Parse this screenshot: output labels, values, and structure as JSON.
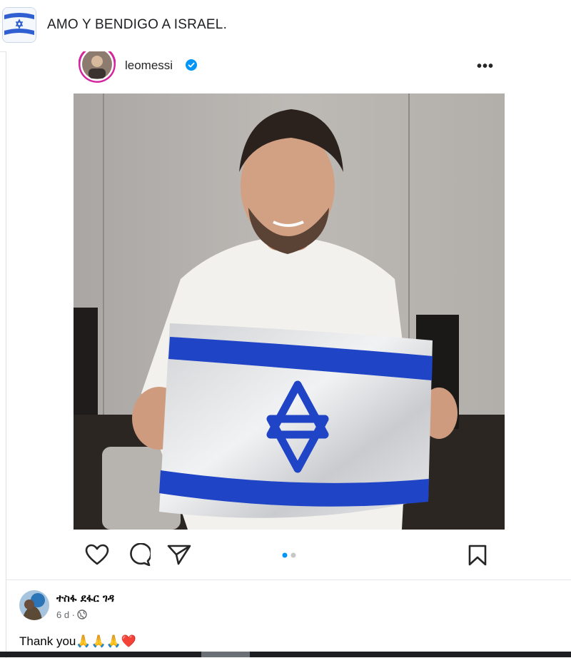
{
  "post": {
    "text": "AMO Y BENDIGO A ISRAEL.",
    "page_avatar_icon": "israel-flag-icon"
  },
  "embed": {
    "username": "leomessi",
    "verified_icon": "verified-badge-icon",
    "more_label": "•••",
    "photo_description_icon": "israel-flag-icon",
    "actions": [
      "heart-icon",
      "comment-icon",
      "share-icon",
      "bookmark-icon"
    ],
    "carousel": {
      "count": 2,
      "active_index": 0
    }
  },
  "comment": {
    "author": "ተስፋ ደፋር ገዳ",
    "time": "6 d ·",
    "privacy_icon": "globe-icon",
    "text": "Thank you🙏🙏🙏❤️"
  },
  "colors": {
    "flag_blue": "#1f44c6",
    "ig_verified": "#0095f6",
    "facebook_text": "#050505",
    "meta_grey": "#65676b"
  }
}
